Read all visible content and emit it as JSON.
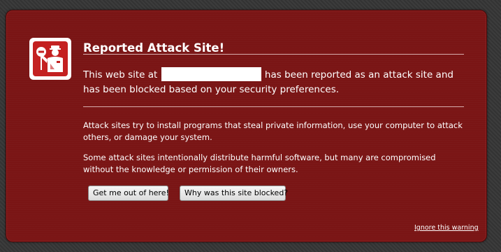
{
  "panel": {
    "title": "Reported Attack Site!",
    "icon": "police-officer-stop-icon",
    "main_before": "This web site at",
    "main_after": "has been reported as an attack site and has been blocked based on your security preferences.",
    "paragraph_1": "Attack sites try to install programs that steal private information, use your computer to attack others, or damage your system.",
    "paragraph_2": "Some attack sites intentionally distribute harmful software, but many are compromised without the knowledge or permission of their owners."
  },
  "buttons": {
    "get_out_label": "Get me out of here!",
    "why_label": "Why was this site blocked?"
  },
  "links": {
    "ignore_label": "Ignore this warning"
  },
  "colors": {
    "panel_background": "#7a1515",
    "text": "#ffffff",
    "icon_red": "#c42121"
  }
}
